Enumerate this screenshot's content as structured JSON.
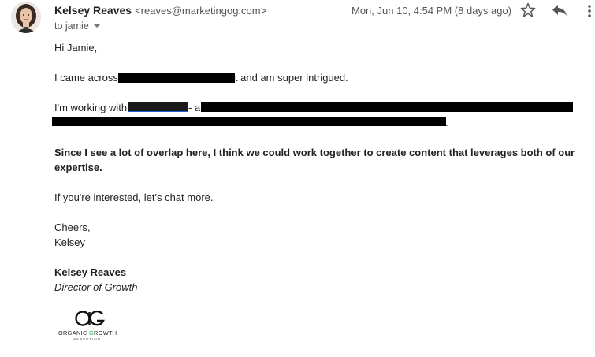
{
  "email": {
    "sender_name": "Kelsey Reaves",
    "sender_email": "<reaves@marketingog.com>",
    "date": "Mon, Jun 10, 4:54 PM (8 days ago)",
    "to": "to jamie",
    "icons": {
      "star": "star-icon",
      "reply": "reply-icon",
      "more": "more-vert-icon",
      "caret": "chevron-down-icon"
    }
  },
  "body": {
    "greeting": "Hi Jamie,",
    "line1_pre": "I came across",
    "line1_mid": "t and am super intrigued.",
    "line2_pre": "I'm working with",
    "line2_dash": "- a",
    "line2_end": ".",
    "highlight_1": "Since I see a lot of overlap here, I think we could work together to create content that leverages both of our",
    "highlight_2": "expertise.",
    "invite": "If you're interested, let's chat more.",
    "signoff_1": "Cheers,",
    "signoff_2": "Kelsey"
  },
  "signature": {
    "name": "Kelsey Reaves",
    "title": "Director of Growth",
    "logo_text": "ORGANIC GROWTH",
    "logo_sub": "MARKETING",
    "logo_mark": "OG",
    "brand_color": "#2ca84a"
  }
}
